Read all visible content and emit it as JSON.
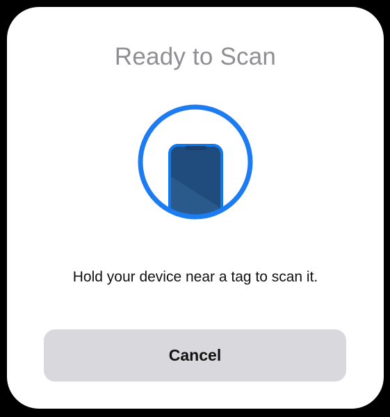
{
  "sheet": {
    "title": "Ready to Scan",
    "message": "Hold your device near a tag to scan it.",
    "cancel_label": "Cancel"
  },
  "icon": {
    "name": "phone-scan-icon",
    "ring_color": "#1e7cf2",
    "phone_color": "#1f4c7c",
    "phone_outline": "#0f7af0"
  },
  "colors": {
    "background": "#000000",
    "sheet": "#ffffff",
    "title_text": "#8e8e93",
    "body_text": "#111111",
    "button_bg": "#d8d8dd"
  }
}
